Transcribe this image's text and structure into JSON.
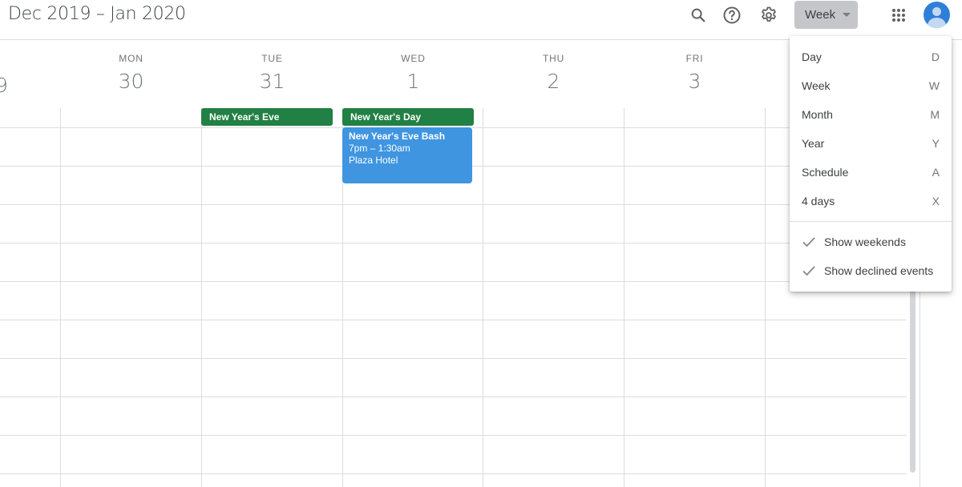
{
  "header": {
    "title": "Dec 2019 – Jan 2020",
    "icons": [
      "search-icon",
      "help-icon",
      "settings-icon",
      "apps-grid-icon",
      "account-avatar"
    ],
    "view_selector": {
      "label": "Week"
    }
  },
  "days": [
    {
      "dow": "",
      "num": ""
    },
    {
      "dow": "MON",
      "num": "30"
    },
    {
      "dow": "TUE",
      "num": "31"
    },
    {
      "dow": "WED",
      "num": "1"
    },
    {
      "dow": "THU",
      "num": "2"
    },
    {
      "dow": "FRI",
      "num": "3"
    }
  ],
  "all_day_events": [
    {
      "day": "TUE 31",
      "title": "New Year's Eve",
      "color": "#218043"
    },
    {
      "day": "WED 1",
      "title": "New Year's Day",
      "color": "#218043"
    }
  ],
  "timed_events": [
    {
      "day": "WED 1",
      "title": "New Year's Eve Bash",
      "time": "7pm – 1:30am",
      "location": "Plaza Hotel",
      "color": "#3f95e0"
    }
  ],
  "view_menu": {
    "items": [
      {
        "label": "Day",
        "shortcut": "D"
      },
      {
        "label": "Week",
        "shortcut": "W"
      },
      {
        "label": "Month",
        "shortcut": "M"
      },
      {
        "label": "Year",
        "shortcut": "Y"
      },
      {
        "label": "Schedule",
        "shortcut": "A"
      },
      {
        "label": "4 days",
        "shortcut": "X"
      }
    ],
    "toggles": [
      {
        "label": "Show weekends",
        "checked": true
      },
      {
        "label": "Show declined events",
        "checked": true
      }
    ]
  }
}
